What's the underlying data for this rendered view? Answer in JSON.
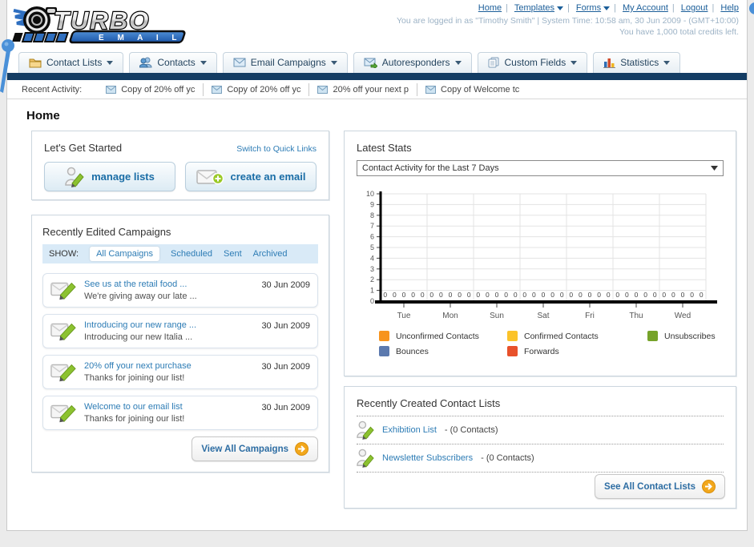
{
  "theme": {
    "navy_bar": "#143d64",
    "link_blue": "#2d7cb5",
    "header_link_blue": "#1b5e99",
    "button_text_blue": "#1a6da6",
    "arrow_orange": "#f2a71b"
  },
  "header": {
    "logo_primary": "TURBO",
    "logo_secondary": "E M A I L",
    "nav": [
      {
        "label": "Home",
        "dropdown": false
      },
      {
        "label": "Templates",
        "dropdown": true
      },
      {
        "label": "Forms",
        "dropdown": true
      },
      {
        "label": "My Account",
        "dropdown": false
      },
      {
        "label": "Logout",
        "dropdown": false
      },
      {
        "label": "Help",
        "dropdown": false
      }
    ],
    "login_line": "You are logged in as \"Timothy Smith\" | System Time: 10:58 am, 30 Jun 2009 - (GMT+10:00)",
    "credits_line": "You have 1,000 total credits left."
  },
  "tabs": [
    {
      "label": "Contact Lists",
      "icon": "folder-icon"
    },
    {
      "label": "Contacts",
      "icon": "contacts-icon"
    },
    {
      "label": "Email Campaigns",
      "icon": "envelope-icon"
    },
    {
      "label": "Autoresponders",
      "icon": "autoresponder-icon"
    },
    {
      "label": "Custom Fields",
      "icon": "custom-fields-icon"
    },
    {
      "label": "Statistics",
      "icon": "statistics-icon"
    }
  ],
  "recent_activity": {
    "label": "Recent Activity:",
    "items": [
      "Copy of 20% off yc",
      "Copy of 20% off yc",
      "20% off your next p",
      "Copy of Welcome tc"
    ]
  },
  "page_title": "Home",
  "get_started": {
    "title": "Let's Get Started",
    "switch_link": "Switch to Quick Links",
    "manage_lists_button": "manage lists",
    "create_email_button": "create an email"
  },
  "campaigns": {
    "title": "Recently Edited Campaigns",
    "show_label": "SHOW:",
    "filters": [
      "All Campaigns",
      "Scheduled",
      "Sent",
      "Archived"
    ],
    "active_filter": "All Campaigns",
    "items": [
      {
        "title": "See us at the retail food ...",
        "subtitle": "We're giving away our late ...",
        "date": "30 Jun 2009"
      },
      {
        "title": "Introducing our new range ...",
        "subtitle": "Introducing our new Italia ...",
        "date": "30 Jun 2009"
      },
      {
        "title": "20% off your next purchase",
        "subtitle": "Thanks for joining our list!",
        "date": "30 Jun 2009"
      },
      {
        "title": "Welcome to our email list",
        "subtitle": "Thanks for joining our list!",
        "date": "30 Jun 2009"
      }
    ],
    "view_all_button": "View All Campaigns"
  },
  "stats": {
    "title": "Latest Stats",
    "dropdown_value": "Contact Activity for the Last 7 Days"
  },
  "chart_data": {
    "type": "bar",
    "title": "Contact Activity for the Last 7 Days",
    "categories": [
      "Tue",
      "Mon",
      "Sun",
      "Sat",
      "Fri",
      "Thu",
      "Wed"
    ],
    "series": [
      {
        "name": "Unconfirmed Contacts",
        "color": "#F7941E",
        "values": [
          0,
          0,
          0,
          0,
          0,
          0,
          0
        ]
      },
      {
        "name": "Confirmed Contacts",
        "color": "#FBC32A",
        "values": [
          0,
          0,
          0,
          0,
          0,
          0,
          0
        ]
      },
      {
        "name": "Unsubscribes",
        "color": "#76A32A",
        "values": [
          0,
          0,
          0,
          0,
          0,
          0,
          0
        ]
      },
      {
        "name": "Bounces",
        "color": "#5B79AE",
        "values": [
          0,
          0,
          0,
          0,
          0,
          0,
          0
        ]
      },
      {
        "name": "Forwards",
        "color": "#E8512B",
        "values": [
          0,
          0,
          0,
          0,
          0,
          0,
          0
        ]
      }
    ],
    "ylim": [
      0,
      10
    ],
    "ytick_step": 1,
    "grid": true,
    "legend_position": "bottom",
    "value_labels_shown": true
  },
  "contact_lists": {
    "title": "Recently Created Contact Lists",
    "items": [
      {
        "name": "Exhibition List",
        "detail": "- (0 Contacts)"
      },
      {
        "name": "Newsletter Subscribers",
        "detail": "- (0 Contacts)"
      }
    ],
    "see_all_button": "See All Contact Lists"
  }
}
